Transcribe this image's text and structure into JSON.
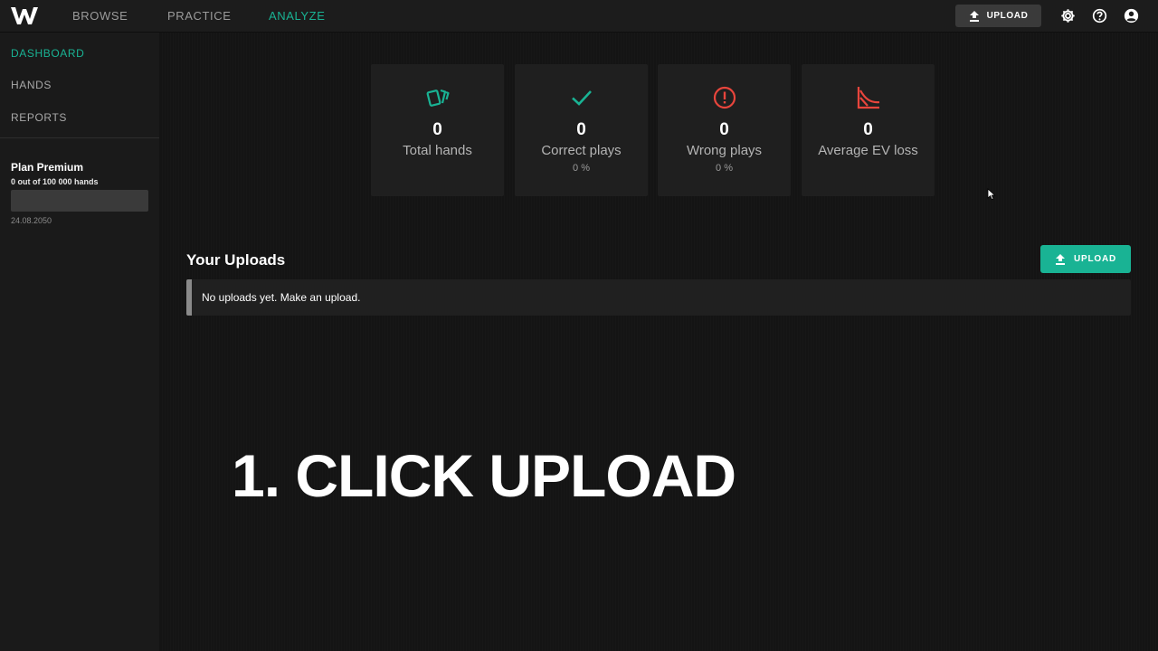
{
  "nav": {
    "items": [
      {
        "label": "BROWSE"
      },
      {
        "label": "PRACTICE"
      },
      {
        "label": "ANALYZE"
      }
    ],
    "active": "ANALYZE",
    "upload_label": "UPLOAD",
    "icons": [
      "gear-icon",
      "help-icon",
      "account-icon"
    ]
  },
  "sidebar": {
    "items": [
      {
        "label": "DASHBOARD"
      },
      {
        "label": "HANDS"
      },
      {
        "label": "REPORTS"
      }
    ],
    "plan": {
      "title": "Plan Premium",
      "usage": "0 out of 100 000 hands",
      "usage_fraction": 0,
      "date": "24.08.2050"
    }
  },
  "stats": [
    {
      "icon": "cards-icon",
      "value": "0",
      "label": "Total hands",
      "sub": ""
    },
    {
      "icon": "check-icon",
      "value": "0",
      "label": "Correct plays",
      "sub": "0 %"
    },
    {
      "icon": "alert-icon",
      "value": "0",
      "label": "Wrong plays",
      "sub": "0 %"
    },
    {
      "icon": "ev-loss-chart-icon",
      "value": "0",
      "label": "Average EV loss",
      "sub": ""
    }
  ],
  "uploads": {
    "title": "Your Uploads",
    "button_label": "UPLOAD",
    "empty_message": "No uploads yet. Make an upload."
  },
  "caption": "1. CLICK UPLOAD",
  "colors": {
    "accent": "#19b394",
    "danger": "#e8453c",
    "background": "#141414",
    "card": "#1f1f1f"
  }
}
